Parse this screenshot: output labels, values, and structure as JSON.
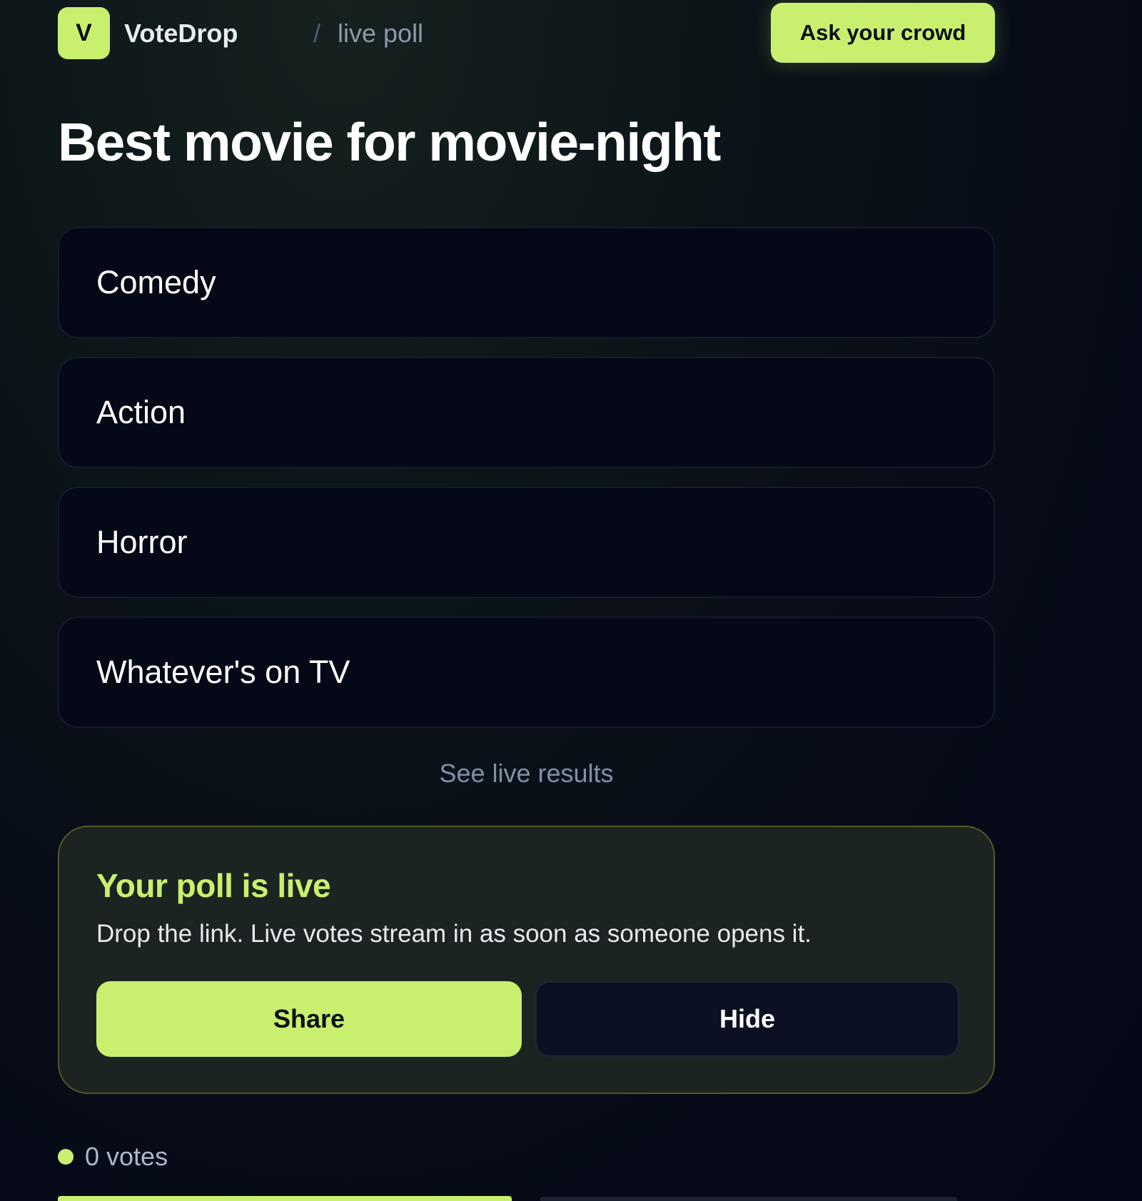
{
  "brand": {
    "logo_letter": "V",
    "name": "VoteDrop",
    "separator": "/",
    "section": "live poll"
  },
  "header": {
    "cta_label": "Ask your crowd"
  },
  "poll": {
    "title": "Best movie for movie-night",
    "options": [
      {
        "label": "Comedy"
      },
      {
        "label": "Action"
      },
      {
        "label": "Horror"
      },
      {
        "label": "Whatever's on TV"
      }
    ],
    "see_results_label": "See live results"
  },
  "live_card": {
    "title": "Your poll is live",
    "description": "Drop the link. Live votes stream in as soon as someone opens it.",
    "share_label": "Share",
    "hide_label": "Hide"
  },
  "status": {
    "votes_text": "0 votes"
  },
  "colors": {
    "accent": "#c8f06e",
    "background": "#060a18",
    "card": "#050816",
    "live_card": "#1c2422"
  }
}
